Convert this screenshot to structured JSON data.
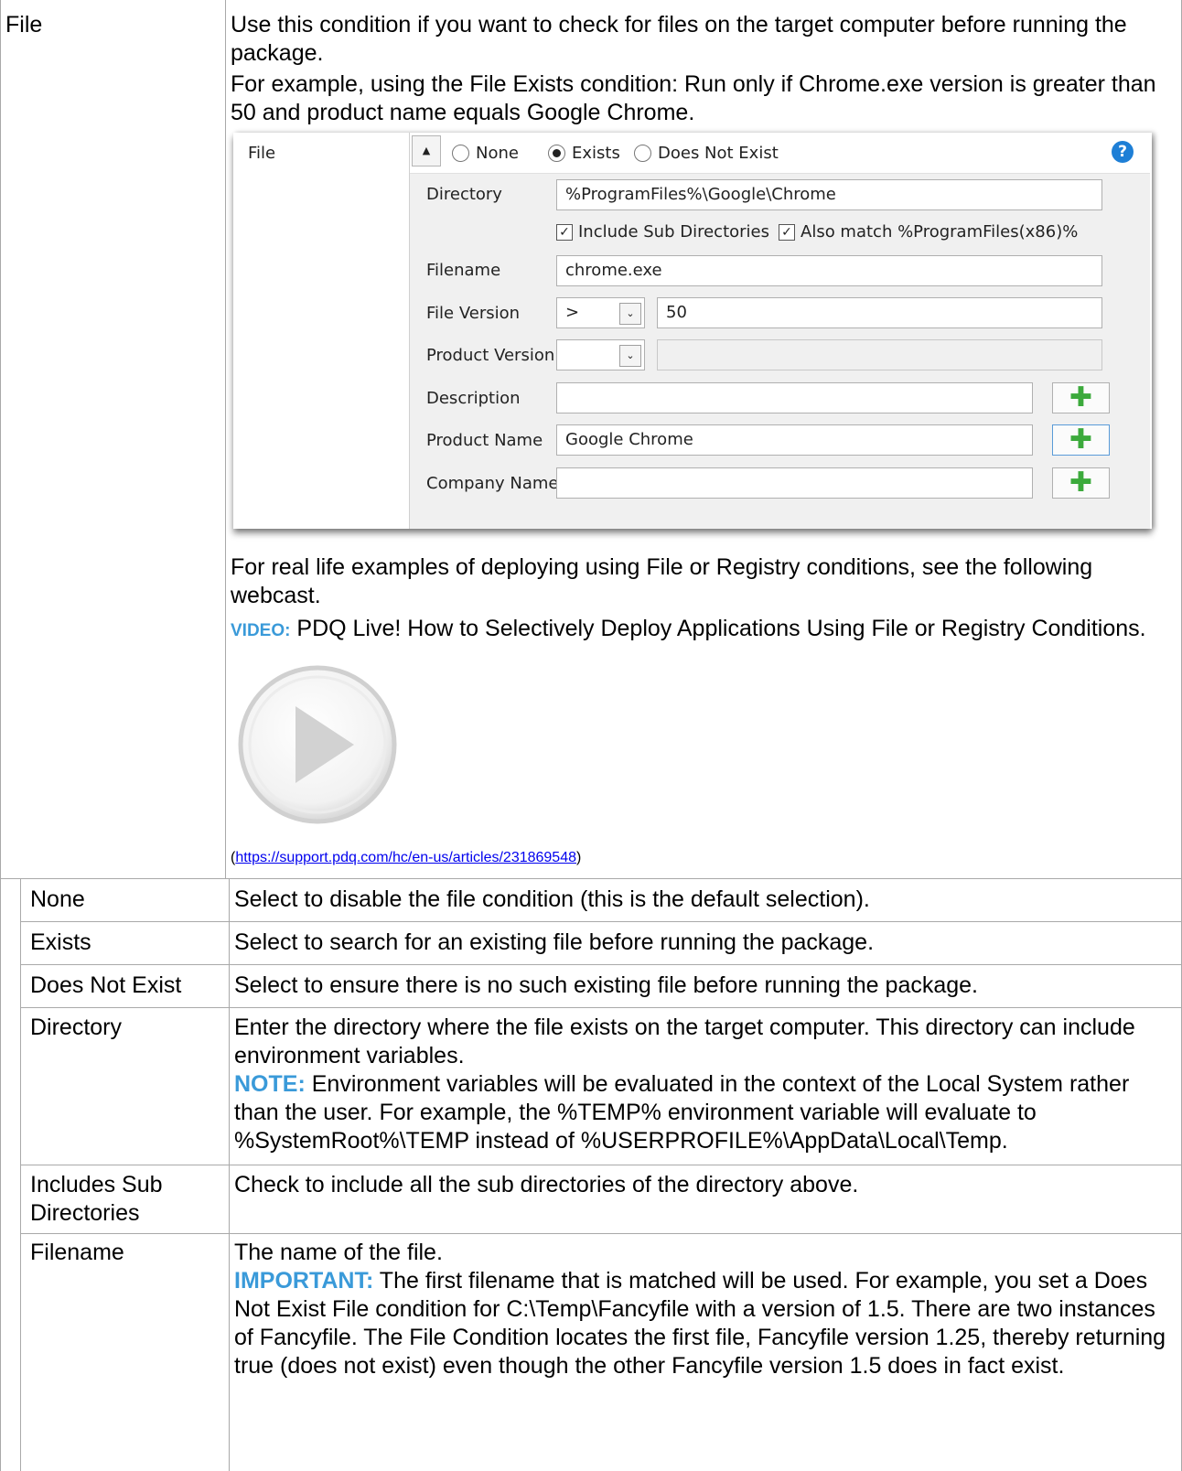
{
  "file_row": {
    "title": "File",
    "intro1": "Use this condition if you want to check for files on the target computer before running the package.",
    "intro2": "For example, using the File Exists condition: Run only if Chrome.exe version is greater than 50 and product name equals Google Chrome.",
    "realLife": "For real life examples of deploying using File or Registry conditions, see the following webcast.",
    "videoLabel": "VIDEO:",
    "videoText": "PDQ Live! How to Selectively Deploy Applications Using File or Registry Conditions.",
    "linkOpen": "(",
    "linkUrl": "https://support.pdq.com/hc/en-us/articles/231869548",
    "linkClose": ")",
    "playIcon": "play-button-icon"
  },
  "screenshot": {
    "fileLabel": "File",
    "radio": [
      {
        "label": "None",
        "selected": false
      },
      {
        "label": "Exists",
        "selected": true
      },
      {
        "label": "Does Not Exist",
        "selected": false
      }
    ],
    "collapseIcon": "▲",
    "helpIcon": "?",
    "directory": {
      "label": "Directory",
      "value": "%ProgramFiles%\\Google\\Chrome"
    },
    "includeSub": {
      "label": "Include Sub Directories",
      "checked": true
    },
    "alsoMatch": {
      "label": "Also match %ProgramFiles(x86)%",
      "checked": true
    },
    "filename": {
      "label": "Filename",
      "value": "chrome.exe"
    },
    "fileVersion": {
      "label": "File Version",
      "operator": ">",
      "value": "50"
    },
    "productVersion": {
      "label": "Product Version",
      "operator": "",
      "value": ""
    },
    "description": {
      "label": "Description",
      "value": ""
    },
    "productName": {
      "label": "Product Name",
      "value": "Google Chrome"
    },
    "companyName": {
      "label": "Company Name",
      "value": ""
    },
    "plusIcon": "✚",
    "checkmark": "✓",
    "dropdownIcon": "⌄"
  },
  "sub_rows": [
    {
      "term": "None",
      "desc": "Select to disable the file condition (this is the default selection)."
    },
    {
      "term": "Exists",
      "desc": "Select to search for an existing file before running the package."
    },
    {
      "term": "Does Not Exist",
      "desc": "Select to ensure there is no such existing file before running the package."
    },
    {
      "term": "Directory",
      "desc": "Enter the directory where the file exists on the target computer. This directory can include environment variables.",
      "noteLabel": "NOTE:",
      "note": "Environment variables will be evaluated in the context of the Local System rather than the user. For example, the %TEMP% environment variable will evaluate to %SystemRoot%\\TEMP instead of %USERPROFILE%\\AppData\\Local\\Temp."
    },
    {
      "term": "Includes Sub Directories",
      "desc": "Check to include all the sub directories of the directory above."
    },
    {
      "term": "Filename",
      "desc": "The name of the file.",
      "noteLabel": "IMPORTANT:",
      "note": "The first filename that is matched will be used. For example, you set a Does Not Exist File condition for C:\\Temp\\Fancyfile with a version of 1.5. There are two instances of Fancyfile. The File Condition locates the first file, Fancyfile version 1.25, thereby returning true (does not exist) even though the other Fancyfile version 1.5 does in fact exist."
    }
  ]
}
